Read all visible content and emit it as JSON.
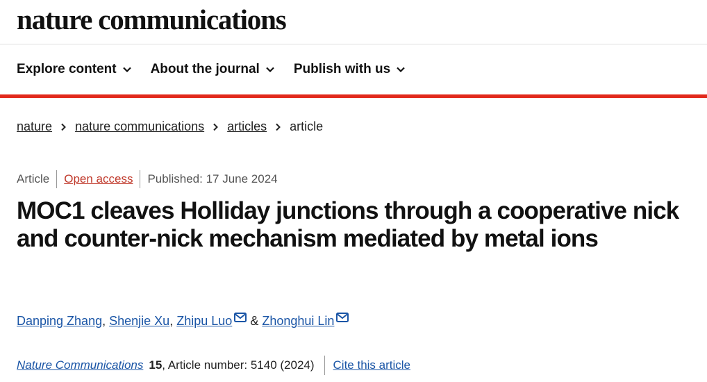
{
  "header": {
    "logo": "nature communications",
    "nav": [
      "Explore content",
      "About the journal",
      "Publish with us"
    ]
  },
  "breadcrumb": [
    "nature",
    "nature communications",
    "articles",
    "article"
  ],
  "article": {
    "type": "Article",
    "access": "Open access",
    "published": "Published: 17 June 2024",
    "title": "MOC1 cleaves Holliday junctions through a cooperative nick and counter-nick mechanism mediated by metal ions",
    "authors": [
      "Danping Zhang",
      "Shenjie Xu",
      "Zhipu Luo",
      "Zhonghui Lin"
    ],
    "author_sep_1": ",",
    "author_sep_2": ",",
    "author_sep_3": "&",
    "journal": "Nature Communications",
    "volume": "15",
    "article_number": ", Article number: 5140 (2024)",
    "cite": "Cite this article"
  },
  "colors": {
    "accent_red": "#e2291c",
    "link_blue": "#1a55a6",
    "open_access": "#c0392b"
  },
  "icons": [
    "chevron-down-icon",
    "chevron-right-icon",
    "envelope-icon"
  ]
}
